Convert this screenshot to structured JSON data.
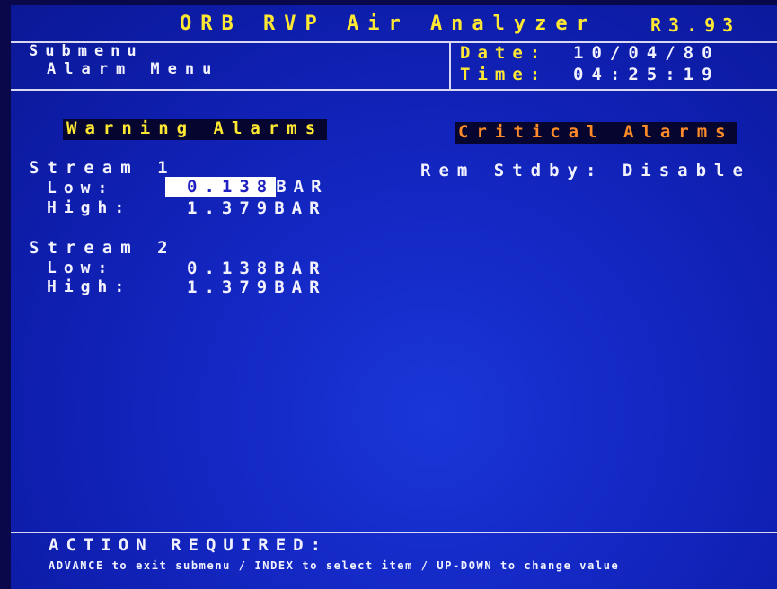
{
  "header": {
    "title": "ORB RVP Air Analyzer",
    "version": "R3.93"
  },
  "submenu": {
    "label": "Submenu",
    "name": "Alarm Menu"
  },
  "datetime": {
    "date_label": "Date:",
    "date_value": "10/04/80",
    "time_label": "Time:",
    "time_value": "04:25:19"
  },
  "sections": {
    "warning": "Warning Alarms",
    "critical": "Critical Alarms"
  },
  "streams": [
    {
      "title": "Stream 1",
      "low_label": "Low:",
      "low_value": "0.138",
      "high_label": "High:",
      "high_value": "1.379",
      "unit": "BAR"
    },
    {
      "title": "Stream 2",
      "low_label": "Low:",
      "low_value": "0.138",
      "high_label": "High:",
      "high_value": "1.379",
      "unit": "BAR"
    }
  ],
  "critical": {
    "rem_stdby": "Rem Stdby: Disable"
  },
  "footer": {
    "action_label": "ACTION REQUIRED:",
    "help": "ADVANCE to exit submenu / INDEX to select item / UP-DOWN to change value"
  },
  "colors": {
    "background": "#1428c4",
    "yellow_text": "#ffe832",
    "white_text": "#f2f2ff",
    "critical_text": "#ff8a28",
    "selection_bg": "#ffffff"
  }
}
